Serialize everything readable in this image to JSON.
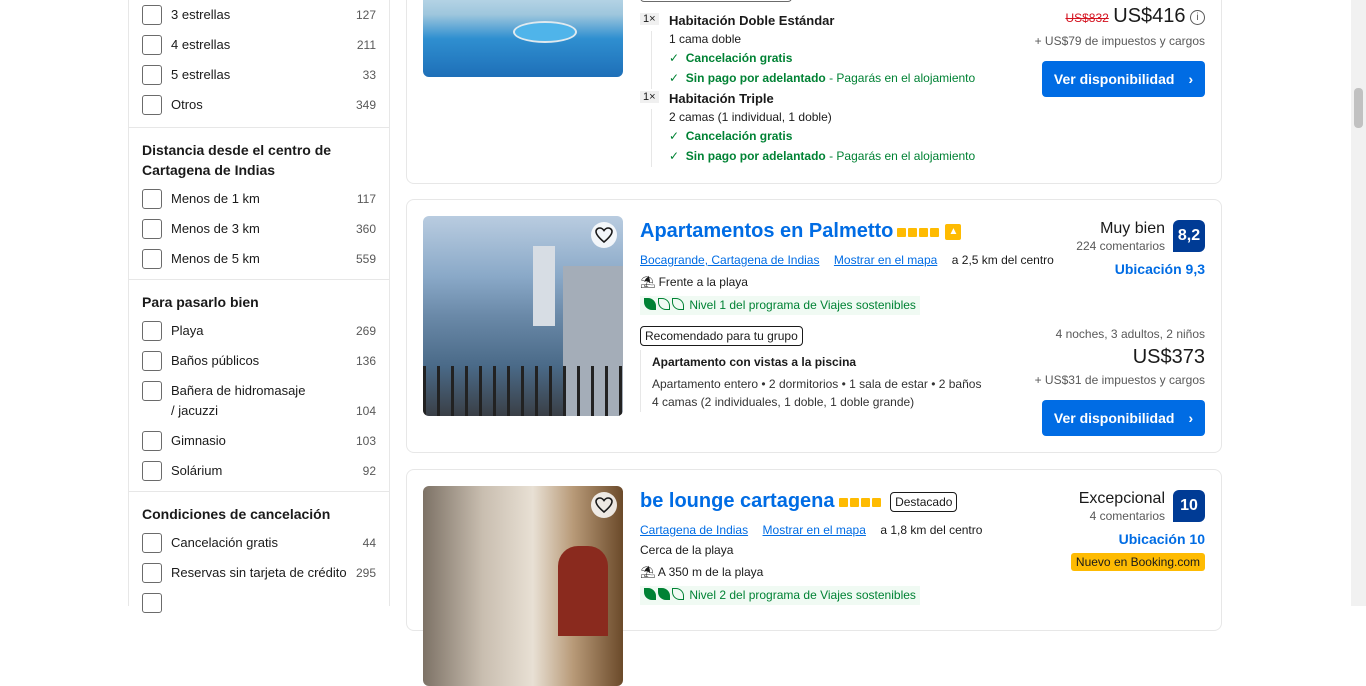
{
  "filters": {
    "stars": [
      {
        "label": "3 estrellas",
        "count": "127"
      },
      {
        "label": "4 estrellas",
        "count": "211"
      },
      {
        "label": "5 estrellas",
        "count": "33"
      },
      {
        "label": "Otros",
        "count": "349"
      }
    ],
    "distance": {
      "title": "Distancia desde el centro de Cartagena de Indias",
      "items": [
        {
          "label": "Menos de 1 km",
          "count": "117"
        },
        {
          "label": "Menos de 3 km",
          "count": "360"
        },
        {
          "label": "Menos de 5 km",
          "count": "559"
        }
      ]
    },
    "fun": {
      "title": "Para pasarlo bien",
      "items": [
        {
          "label": "Playa",
          "count": "269"
        },
        {
          "label": "Baños públicos",
          "count": "136"
        },
        {
          "label": "Bañera de hidromasaje / jacuzzi",
          "count": "104"
        },
        {
          "label": "Gimnasio",
          "count": "103"
        },
        {
          "label": "Solárium",
          "count": "92"
        }
      ]
    },
    "cancel": {
      "title": "Condiciones de cancelación",
      "items": [
        {
          "label": "Cancelación gratis",
          "count": "44"
        },
        {
          "label": "Reservas sin tarjeta de crédito",
          "count": "295"
        }
      ]
    }
  },
  "card1": {
    "rooms": [
      {
        "qty": "1×",
        "name": "Habitación Doble Estándar",
        "beds": "1 cama doble",
        "cancel": "Cancelación gratis",
        "prepay": "Sin pago por adelantado",
        "prepay_note": "- Pagarás en el alojamiento"
      },
      {
        "qty": "1×",
        "name": "Habitación Triple",
        "beds": "2 camas (1 individual, 1 doble)",
        "cancel": "Cancelación gratis",
        "prepay": "Sin pago por adelantado",
        "prepay_note": "- Pagarás en el alojamiento"
      }
    ],
    "old_price": "US$832",
    "price": "US$416",
    "taxes": "+ US$79 de impuestos y cargos",
    "button": "Ver disponibilidad"
  },
  "card2": {
    "title": "Apartamentos en Palmetto",
    "location": "Bocagrande, Cartagena de Indias",
    "map": "Mostrar en el mapa",
    "distance": "a 2,5 km del centro",
    "beach": "Frente a la playa",
    "sustain": "Nivel 1 del programa de Viajes sostenibles",
    "badge": "Recomendado para tu grupo",
    "room_name": "Apartamento con vistas a la piscina",
    "room_desc": "Apartamento entero • 2 dormitorios • 1 sala de estar • 2 baños",
    "room_beds": "4 camas (2 individuales, 1 doble, 1 doble grande)",
    "rating_word": "Muy bien",
    "reviews": "224 comentarios",
    "score": "8,2",
    "location_score": "Ubicación 9,3",
    "stay": "4 noches, 3 adultos, 2 niños",
    "price": "US$373",
    "taxes": "+ US$31 de impuestos y cargos",
    "button": "Ver disponibilidad"
  },
  "card3": {
    "title": "be lounge cartagena",
    "featured": "Destacado",
    "location": "Cartagena de Indias",
    "map": "Mostrar en el mapa",
    "distance": "a 1,8 km del centro",
    "near_beach": "Cerca de la playa",
    "beach_dist": "A 350 m de la playa",
    "sustain": "Nivel 2 del programa de Viajes sostenibles",
    "rating_word": "Excepcional",
    "reviews": "4 comentarios",
    "score": "10",
    "location_score": "Ubicación 10",
    "new_badge": "Nuevo en Booking.com"
  },
  "colors": {
    "brand_blue": "#006ce4",
    "score_blue": "#003b95",
    "green": "#008234",
    "star_yellow": "#febb02"
  }
}
